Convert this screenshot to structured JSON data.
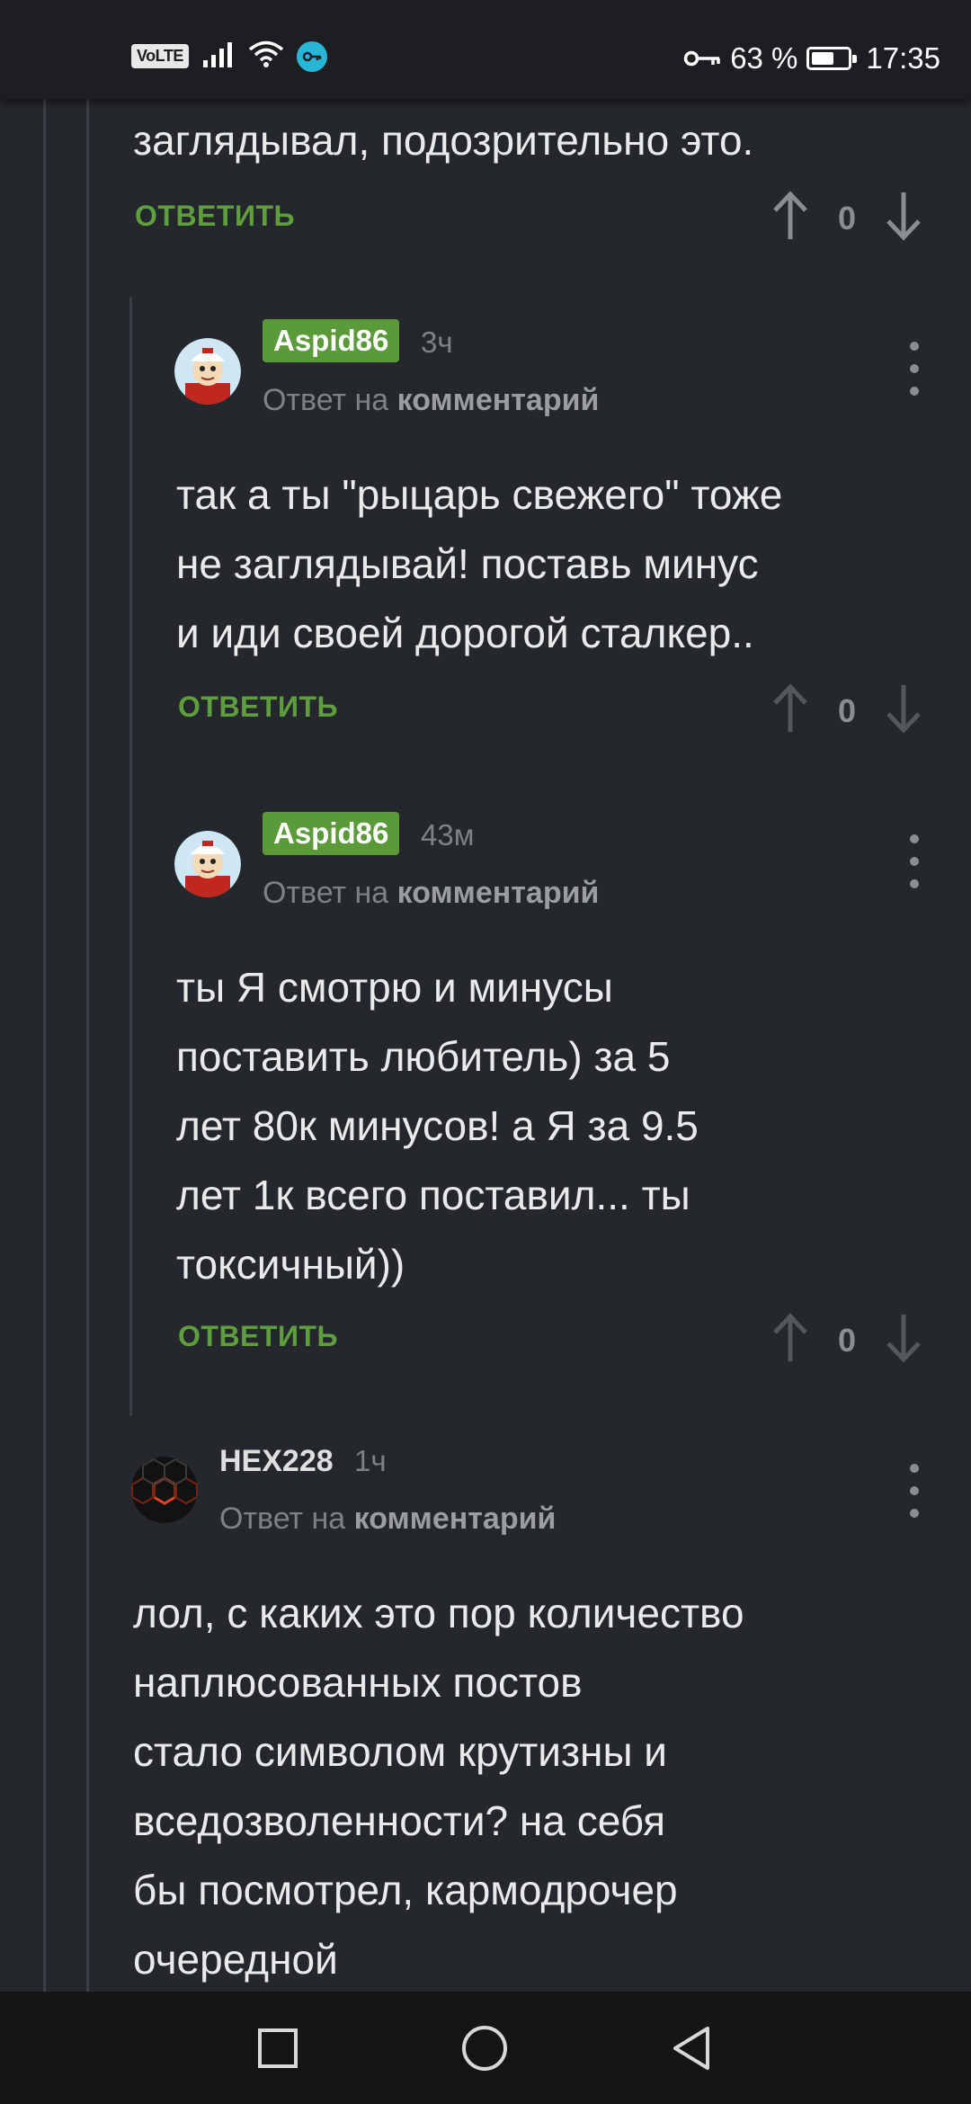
{
  "status_bar": {
    "network_badge": "VoLTE",
    "battery_percent": "63 %",
    "battery_level": 0.63,
    "time": "17:35",
    "icons": [
      "signal-icon",
      "wifi-icon",
      "vpn-key-icon",
      "key-icon",
      "battery-icon"
    ]
  },
  "top_comment": {
    "text_tail": "заглядывал, подозрительно это.",
    "reply_label": "ОТВЕТИТЬ",
    "score": "0"
  },
  "comments": [
    {
      "author": "Aspid86",
      "time": "3ч",
      "reply_to_prefix": "Ответ на",
      "reply_to_link": "комментарий",
      "lines": [
        "так а ты \"рыцарь свежего\" тоже",
        "не заглядывай! поставь минус",
        "и иди своей дорогой сталкер.."
      ],
      "reply_label": "ОТВЕТИТЬ",
      "score": "0"
    },
    {
      "author": "Aspid86",
      "time": "43м",
      "reply_to_prefix": "Ответ на",
      "reply_to_link": "комментарий",
      "lines": [
        "ты Я смотрю и минусы",
        "поставить любитель) за 5",
        "лет 80к минусов! а Я за 9.5",
        "лет 1к всего поставил... ты",
        "токсичный))"
      ],
      "reply_label": "ОТВЕТИТЬ",
      "score": "0"
    },
    {
      "author": "HEX228",
      "time": "1ч",
      "reply_to_prefix": "Ответ на",
      "reply_to_link": "комментарий",
      "lines": [
        "лол, с каких это пор количество",
        "наплюсованных постов",
        "стало символом крутизны и",
        "вседозволенности? на себя",
        "бы посмотрел, кармодрочер",
        "очередной"
      ]
    }
  ],
  "colors": {
    "background": "#24272b",
    "reply_green": "#5f9e3e",
    "badge_green": "#5a9a3a"
  }
}
